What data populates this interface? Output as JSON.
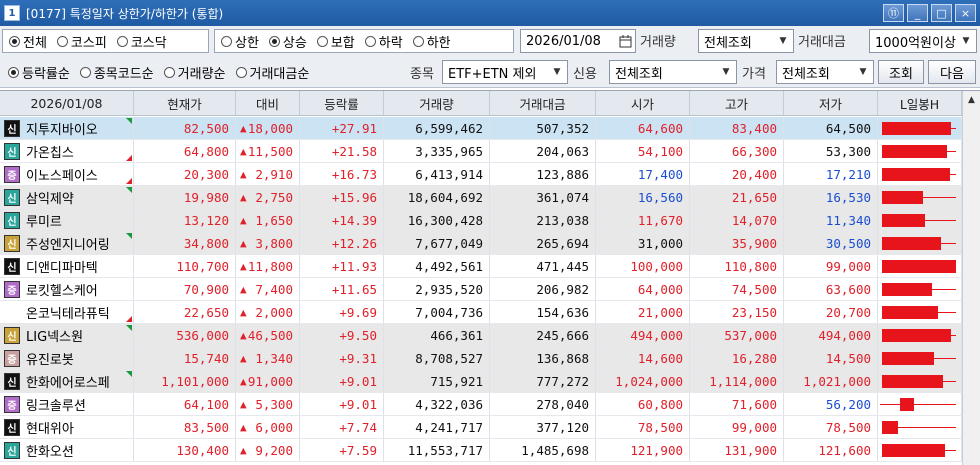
{
  "window": {
    "num_badge": "1",
    "title": "[0177] 특정일자 상한가/하한가 (통합)",
    "btns": [
      "⑪",
      "_",
      "□",
      "×"
    ]
  },
  "row1": {
    "market_radios": [
      {
        "label": "전체",
        "checked": true
      },
      {
        "label": "코스피",
        "checked": false
      },
      {
        "label": "코스닥",
        "checked": false
      }
    ],
    "type_radios": [
      {
        "label": "상한",
        "checked": false
      },
      {
        "label": "상승",
        "checked": true
      },
      {
        "label": "보합",
        "checked": false
      },
      {
        "label": "하락",
        "checked": false
      },
      {
        "label": "하한",
        "checked": false
      }
    ],
    "date": "2026/01/08",
    "volume_label": "거래량",
    "volume_value": "전체조회",
    "amount_label": "거래대금",
    "amount_value": "1000억원이상"
  },
  "row2": {
    "sort_radios": [
      {
        "label": "등락률순",
        "checked": true
      },
      {
        "label": "종목코드순",
        "checked": false
      },
      {
        "label": "거래량순",
        "checked": false
      },
      {
        "label": "거래대금순",
        "checked": false
      }
    ],
    "stock_label": "종목",
    "stock_value": "ETF+ETN 제외",
    "credit_label": "신용",
    "credit_value": "전체조회",
    "price_label": "가격",
    "price_value": "전체조회",
    "search_btn": "조회",
    "next_btn": "다음"
  },
  "grid": {
    "headers": [
      "2026/01/08",
      "현재가",
      "대비",
      "등락률",
      "거래량",
      "거래대금",
      "시가",
      "고가",
      "저가",
      "L일봉H"
    ],
    "rows": [
      {
        "badge": "신",
        "badge_color": "#111111",
        "name": "지투지바이오",
        "price": "82,500",
        "change": "18,000",
        "rate": "+27.91",
        "volume": "6,599,462",
        "amount": "507,352",
        "open": "64,600",
        "open_c": "up",
        "high": "83,400",
        "high_c": "up",
        "low": "64,500",
        "low_c": "black",
        "bar": 0.93,
        "tri": "top"
      },
      {
        "badge": "신",
        "badge_color": "#2aa59a",
        "name": "가온칩스",
        "price": "64,800",
        "change": "11,500",
        "rate": "+21.58",
        "volume": "3,335,965",
        "amount": "204,063",
        "open": "54,100",
        "open_c": "up",
        "high": "66,300",
        "high_c": "up",
        "low": "53,300",
        "low_c": "black",
        "bar": 0.88,
        "tri": "bottom-red"
      },
      {
        "badge": "증",
        "badge_color": "#b06cc8",
        "name": "이노스페이스",
        "price": "20,300",
        "change": "2,910",
        "rate": "+16.73",
        "volume": "6,413,914",
        "amount": "123,886",
        "open": "17,400",
        "open_c": "blue",
        "high": "20,400",
        "high_c": "up",
        "low": "17,210",
        "low_c": "blue",
        "bar": 0.92,
        "tri": "bottom-red"
      },
      {
        "badge": "신",
        "badge_color": "#2aa59a",
        "name": "삼익제약",
        "price": "19,980",
        "change": "2,750",
        "rate": "+15.96",
        "volume": "18,604,692",
        "amount": "361,074",
        "open": "16,560",
        "open_c": "blue",
        "high": "21,650",
        "high_c": "up",
        "low": "16,530",
        "low_c": "blue",
        "bar": 0.55,
        "tri": "top"
      },
      {
        "badge": "신",
        "badge_color": "#2aa59a",
        "name": "루미르",
        "price": "13,120",
        "change": "1,650",
        "rate": "+14.39",
        "volume": "16,300,428",
        "amount": "213,038",
        "open": "11,670",
        "open_c": "up",
        "high": "14,070",
        "high_c": "up",
        "low": "11,340",
        "low_c": "blue",
        "bar": 0.58,
        "tri": "none"
      },
      {
        "badge": "신",
        "badge_color": "#c9a23a",
        "name": "주성엔지니어링",
        "price": "34,800",
        "change": "3,800",
        "rate": "+12.26",
        "volume": "7,677,049",
        "amount": "265,694",
        "open": "31,000",
        "open_c": "black",
        "high": "35,900",
        "high_c": "up",
        "low": "30,500",
        "low_c": "blue",
        "bar": 0.8,
        "tri": "top"
      },
      {
        "badge": "신",
        "badge_color": "#111111",
        "name": "디앤디파마텍",
        "price": "110,700",
        "change": "11,800",
        "rate": "+11.93",
        "volume": "4,492,561",
        "amount": "471,445",
        "open": "100,000",
        "open_c": "up",
        "high": "110,800",
        "high_c": "up",
        "low": "99,000",
        "low_c": "up",
        "bar": 1.0,
        "tri": "none"
      },
      {
        "badge": "증",
        "badge_color": "#b06cc8",
        "name": "로킷헬스케어",
        "price": "70,900",
        "change": "7,400",
        "rate": "+11.65",
        "volume": "2,935,520",
        "amount": "206,982",
        "open": "64,000",
        "open_c": "up",
        "high": "74,500",
        "high_c": "up",
        "low": "63,600",
        "low_c": "up",
        "bar": 0.68,
        "tri": "none"
      },
      {
        "badge": "",
        "badge_color": "",
        "name": "온코닉테라퓨틱",
        "price": "22,650",
        "change": "2,000",
        "rate": "+9.69",
        "volume": "7,004,736",
        "amount": "154,636",
        "open": "21,000",
        "open_c": "up",
        "high": "23,150",
        "high_c": "up",
        "low": "20,700",
        "low_c": "up",
        "bar": 0.75,
        "tri": "bottom-red"
      },
      {
        "badge": "신",
        "badge_color": "#c9a23a",
        "name": "LIG넥스원",
        "price": "536,000",
        "change": "46,500",
        "rate": "+9.50",
        "volume": "466,361",
        "amount": "245,666",
        "open": "494,000",
        "open_c": "up",
        "high": "537,000",
        "high_c": "up",
        "low": "494,000",
        "low_c": "up",
        "bar": 0.93,
        "tri": "top"
      },
      {
        "badge": "증",
        "badge_color": "#c8a0a0",
        "name": "유진로봇",
        "price": "15,740",
        "change": "1,340",
        "rate": "+9.31",
        "volume": "8,708,527",
        "amount": "136,868",
        "open": "14,600",
        "open_c": "up",
        "high": "16,280",
        "high_c": "up",
        "low": "14,500",
        "low_c": "up",
        "bar": 0.7,
        "tri": "none"
      },
      {
        "badge": "신",
        "badge_color": "#111111",
        "name": "한화에어로스페",
        "price": "1,101,000",
        "change": "91,000",
        "rate": "+9.01",
        "volume": "715,921",
        "amount": "777,272",
        "open": "1,024,000",
        "open_c": "up",
        "high": "1,114,000",
        "high_c": "up",
        "low": "1,021,000",
        "low_c": "up",
        "bar": 0.82,
        "tri": "top"
      },
      {
        "badge": "증",
        "badge_color": "#b06cc8",
        "name": "링크솔루션",
        "price": "64,100",
        "change": "5,300",
        "rate": "+9.01",
        "volume": "4,322,036",
        "amount": "278,040",
        "open": "60,800",
        "open_c": "up",
        "high": "71,600",
        "high_c": "up",
        "low": "56,200",
        "low_c": "blue",
        "bar": 0.2,
        "tri": "none"
      },
      {
        "badge": "신",
        "badge_color": "#111111",
        "name": "현대위아",
        "price": "83,500",
        "change": "6,000",
        "rate": "+7.74",
        "volume": "4,241,717",
        "amount": "377,120",
        "open": "78,500",
        "open_c": "up",
        "high": "99,000",
        "high_c": "up",
        "low": "78,500",
        "low_c": "up",
        "bar": 0.22,
        "tri": "none"
      },
      {
        "badge": "신",
        "badge_color": "#2aa59a",
        "name": "한화오션",
        "price": "130,400",
        "change": "9,200",
        "rate": "+7.59",
        "volume": "11,553,717",
        "amount": "1,485,698",
        "open": "121,900",
        "open_c": "up",
        "high": "131,900",
        "high_c": "up",
        "low": "121,600",
        "low_c": "up",
        "bar": 0.85,
        "tri": "none"
      }
    ]
  }
}
